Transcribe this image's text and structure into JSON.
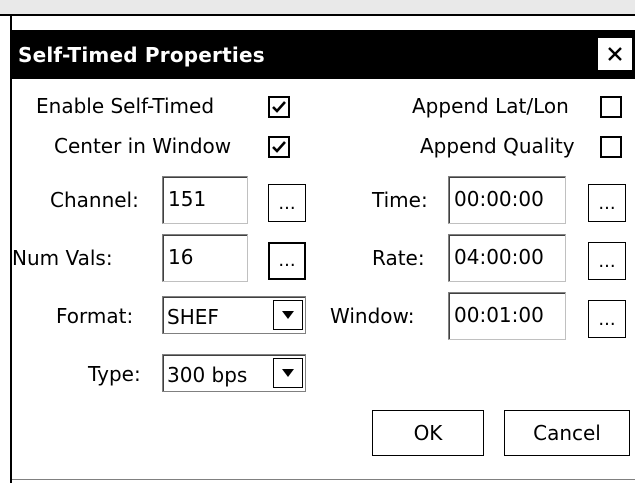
{
  "dialog": {
    "title": "Self-Timed Properties",
    "close_icon": "close-icon"
  },
  "checkboxes": {
    "enable_self_timed": {
      "label": "Enable Self-Timed",
      "checked": true
    },
    "center_in_window": {
      "label": "Center in Window",
      "checked": true
    },
    "append_lat_lon": {
      "label": "Append Lat/Lon",
      "checked": false
    },
    "append_quality": {
      "label": "Append Quality",
      "checked": false
    }
  },
  "left": {
    "channel": {
      "label": "Channel:",
      "value": "151",
      "browse": "..."
    },
    "num_vals": {
      "label": "Num Vals:",
      "value": "16",
      "browse": "..."
    },
    "format": {
      "label": "Format:",
      "value": "SHEF"
    },
    "type": {
      "label": "Type:",
      "value": "300 bps"
    }
  },
  "right": {
    "time": {
      "label": "Time:",
      "value": "00:00:00",
      "browse": "..."
    },
    "rate": {
      "label": "Rate:",
      "value": "04:00:00",
      "browse": "..."
    },
    "window": {
      "label": "Window:",
      "value": "00:01:00",
      "browse": "..."
    }
  },
  "buttons": {
    "ok": "OK",
    "cancel": "Cancel"
  }
}
